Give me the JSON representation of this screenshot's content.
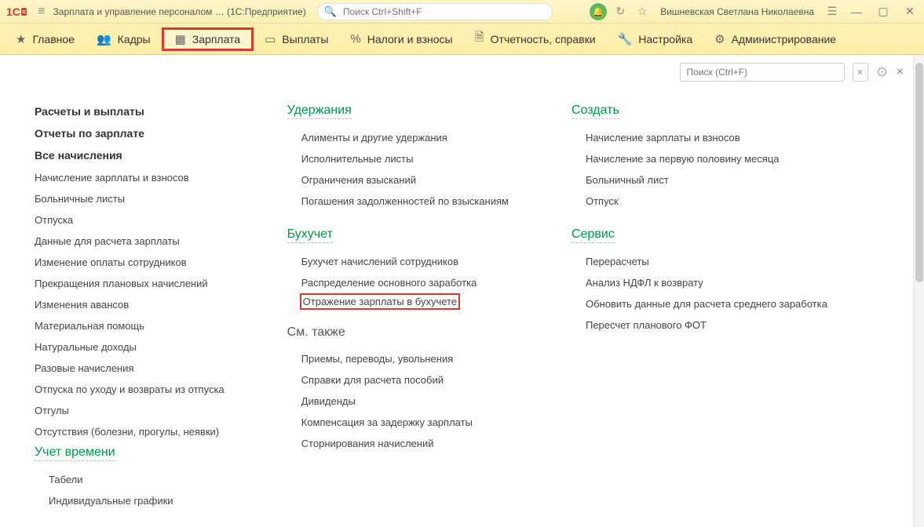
{
  "titlebar": {
    "app_title": "Зарплата и управление персоналом …  (1С:Предприятие)",
    "search_placeholder": "Поиск Ctrl+Shift+F",
    "username": "Вишневская Светлана Николаевна"
  },
  "tabs": {
    "main": "Главное",
    "kadry": "Кадры",
    "zarplata": "Зарплата",
    "vyplaty": "Выплаты",
    "nalogi": "Налоги и взносы",
    "otchet": "Отчетность, справки",
    "nastr": "Настройка",
    "admin": "Администрирование"
  },
  "panel": {
    "search_placeholder": "Поиск (Ctrl+F)"
  },
  "col1": {
    "bold": [
      "Расчеты и выплаты",
      "Отчеты по зарплате",
      "Все начисления"
    ],
    "links": [
      "Начисление зарплаты и взносов",
      "Больничные листы",
      "Отпуска",
      "Данные для расчета зарплаты",
      "Изменение оплаты сотрудников",
      "Прекращения плановых начислений",
      "Изменения авансов",
      "Материальная помощь",
      "Натуральные доходы",
      "Разовые начисления",
      "Отпуска по уходу и возвраты из отпуска",
      "Отгулы",
      "Отсутствия (болезни, прогулы, неявки)"
    ],
    "time_title": "Учет времени",
    "time_links": [
      "Табели",
      "Индивидуальные графики"
    ]
  },
  "col2": {
    "uder_title": "Удержания",
    "uder": [
      "Алименты и другие удержания",
      "Исполнительные листы",
      "Ограничения взысканий",
      "Погашения задолженностей по взысканиям"
    ],
    "buh_title": "Бухучет",
    "buh": [
      "Бухучет начислений сотрудников",
      "Распределение основного заработка"
    ],
    "buh_highlight": "Отражение зарплаты в бухучете",
    "see_title": "См. также",
    "see": [
      "Приемы, переводы, увольнения",
      "Справки для расчета пособий",
      "Дивиденды",
      "Компенсация за задержку зарплаты",
      "Сторнирования начислений"
    ]
  },
  "col3": {
    "create_title": "Создать",
    "create": [
      "Начисление зарплаты и взносов",
      "Начисление за первую половину месяца",
      "Больничный лист",
      "Отпуск"
    ],
    "service_title": "Сервис",
    "service": [
      "Перерасчеты",
      "Анализ НДФЛ к возврату",
      "Обновить данные для расчета среднего заработка",
      "Пересчет планового ФОТ"
    ]
  }
}
